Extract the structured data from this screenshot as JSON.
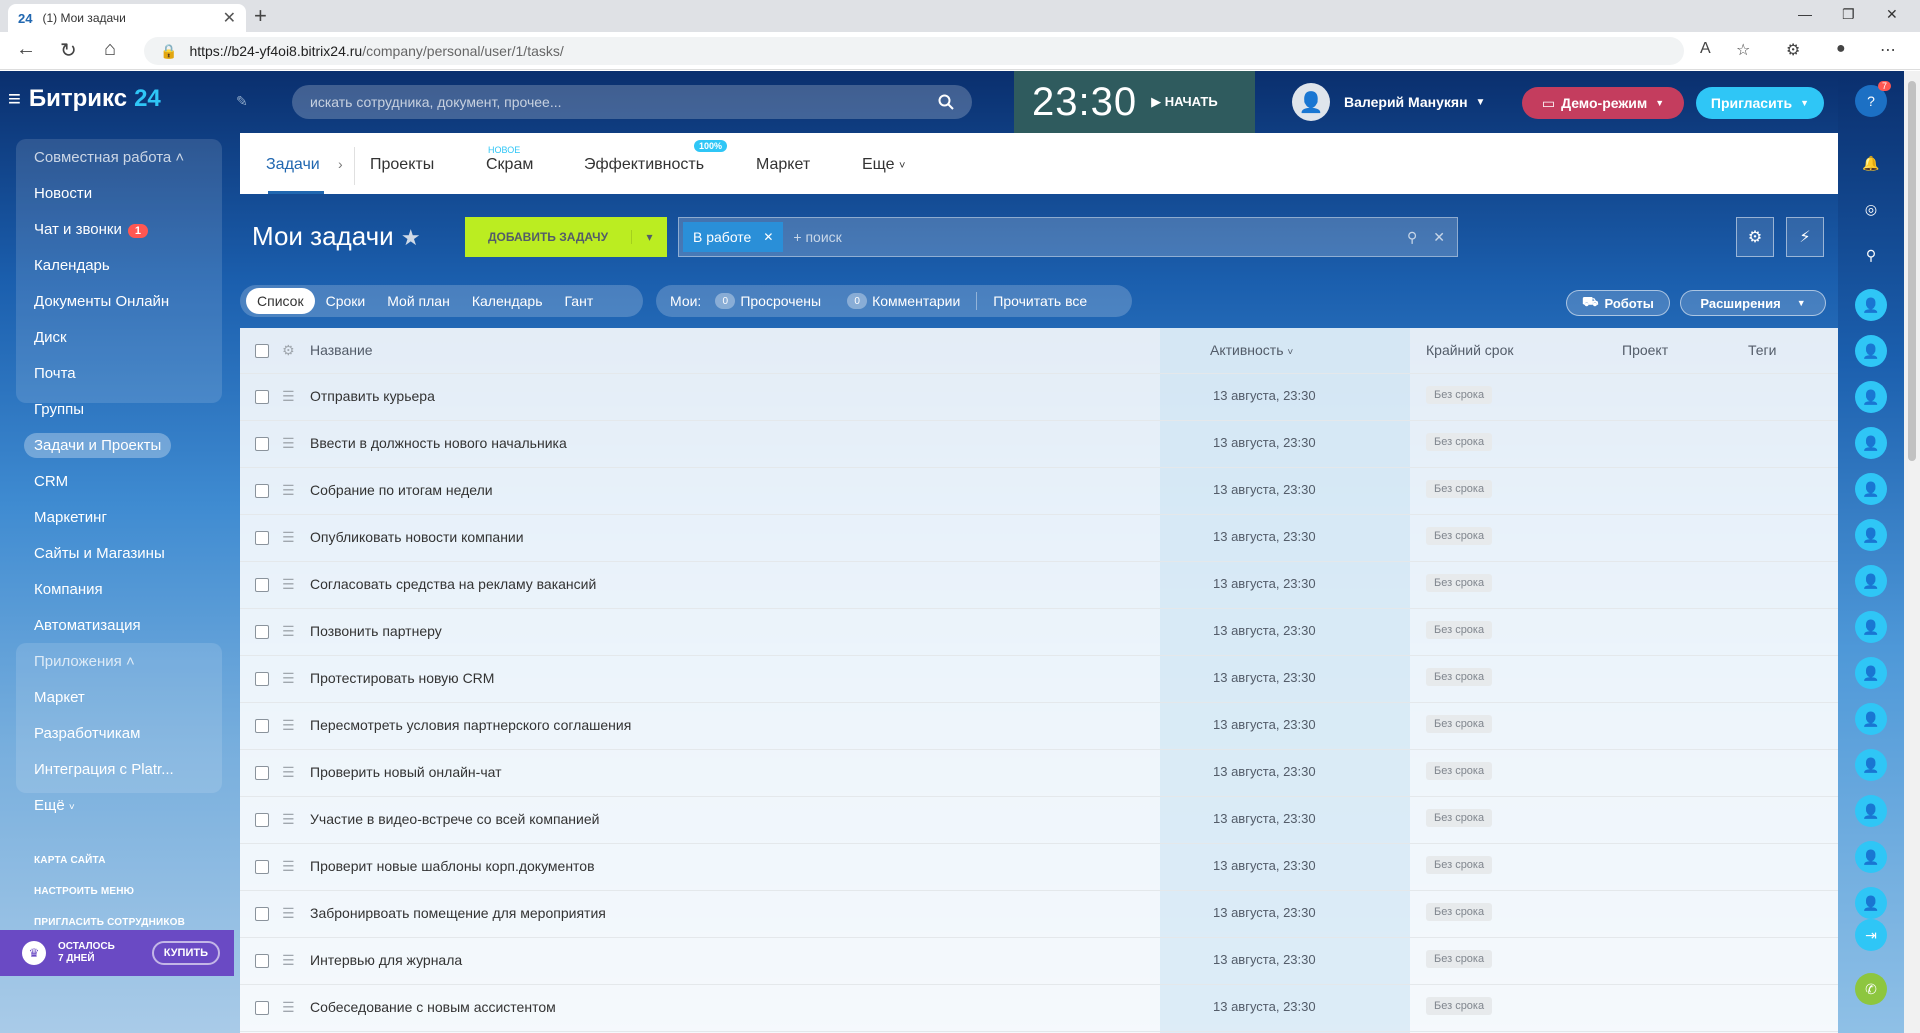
{
  "browser": {
    "tab_favicon": "24",
    "tab_title": "(1) Мои задачи",
    "url_prefix": "https://",
    "url_host": "b24-yf4oi8.bitrix24.ru",
    "url_path": "/company/personal/user/1/tasks/"
  },
  "header": {
    "logo_name": "Битрикс",
    "logo_num": "24",
    "search_placeholder": "искать сотрудника, документ, прочее...",
    "time": "23:30",
    "start_label": "НАЧАТЬ",
    "user_name": "Валерий Манукян",
    "demo_label": "Демо-режим",
    "invite_label": "Пригласить",
    "help_badge": "7"
  },
  "leftmenu": {
    "group1_header": "Совместная работа",
    "items1": [
      "Новости",
      "Чат и звонки",
      "Календарь",
      "Документы Онлайн",
      "Диск",
      "Почта",
      "Группы"
    ],
    "chat_badge": "1",
    "active_item": "Задачи и Проекты",
    "items2": [
      "CRM",
      "Маркетинг",
      "Сайты и Магазины",
      "Компания",
      "Автоматизация"
    ],
    "group2_header": "Приложения",
    "items3": [
      "Маркет",
      "Разработчикам",
      "Интеграция с Platr..."
    ],
    "more": "Ещё",
    "links": [
      "КАРТА САЙТА",
      "НАСТРОИТЬ МЕНЮ",
      "ПРИГЛАСИТЬ СОТРУДНИКОВ"
    ],
    "trial_line1": "ОСТАЛОСЬ",
    "trial_line2": "7 ДНЕЙ",
    "buy_label": "КУПИТЬ"
  },
  "tabs": {
    "tasks": "Задачи",
    "projects": "Проекты",
    "scrum": "Скрам",
    "scrum_new": "НОВОЕ",
    "efficiency": "Эффективность",
    "efficiency_badge": "100%",
    "market": "Маркет",
    "more": "Еще"
  },
  "page": {
    "title": "Мои задачи",
    "add_task": "ДОБАВИТЬ ЗАДАЧУ",
    "filter_chip": "В работе",
    "filter_search": "+ поиск"
  },
  "views": {
    "list": "Список",
    "deadlines": "Сроки",
    "myplan": "Мой план",
    "calendar": "Календарь",
    "gantt": "Гант"
  },
  "counters": {
    "mine_label": "Мои:",
    "overdue_count": "0",
    "overdue_label": "Просрочены",
    "comments_count": "0",
    "comments_label": "Комментарии",
    "read_all": "Прочитать все"
  },
  "actions": {
    "robots": "Роботы",
    "extensions": "Расширения"
  },
  "table": {
    "col_name": "Название",
    "col_activity": "Активность",
    "col_deadline": "Крайний срок",
    "col_project": "Проект",
    "col_tags": "Теги",
    "rows": [
      {
        "name": "Отправить курьера",
        "activity": "13 августа, 23:30",
        "deadline": "Без срока"
      },
      {
        "name": "Ввести в должность нового начальника",
        "activity": "13 августа, 23:30",
        "deadline": "Без срока"
      },
      {
        "name": "Собрание по итогам недели",
        "activity": "13 августа, 23:30",
        "deadline": "Без срока"
      },
      {
        "name": "Опубликовать новости компании",
        "activity": "13 августа, 23:30",
        "deadline": "Без срока"
      },
      {
        "name": "Согласовать средства на рекламу вакансий",
        "activity": "13 августа, 23:30",
        "deadline": "Без срока"
      },
      {
        "name": "Позвонить партнеру",
        "activity": "13 августа, 23:30",
        "deadline": "Без срока"
      },
      {
        "name": "Протестировать новую CRM",
        "activity": "13 августа, 23:30",
        "deadline": "Без срока"
      },
      {
        "name": "Пересмотреть условия партнерского соглашения",
        "activity": "13 августа, 23:30",
        "deadline": "Без срока"
      },
      {
        "name": "Проверить новый онлайн-чат",
        "activity": "13 августа, 23:30",
        "deadline": "Без срока"
      },
      {
        "name": "Участие в видео-встрече со всей компанией",
        "activity": "13 августа, 23:30",
        "deadline": "Без срока"
      },
      {
        "name": "Проверит новые шаблоны корп.документов",
        "activity": "13 августа, 23:30",
        "deadline": "Без срока"
      },
      {
        "name": "Забронирвоать помещение для мероприятия",
        "activity": "13 августа, 23:30",
        "deadline": "Без срока"
      },
      {
        "name": "Интервью для журнала",
        "activity": "13 августа, 23:30",
        "deadline": "Без срока"
      },
      {
        "name": "Собеседование с новым ассистентом",
        "activity": "13 августа, 23:30",
        "deadline": "Без срока"
      }
    ]
  },
  "colors": {
    "accent": "#2067b0",
    "add_task_bg": "#bbed21",
    "invite_bg": "#2fc6f6",
    "demo_bg": "#c43d5e",
    "trial_bg": "#6a4ac4",
    "badge_red": "#ff5752"
  }
}
